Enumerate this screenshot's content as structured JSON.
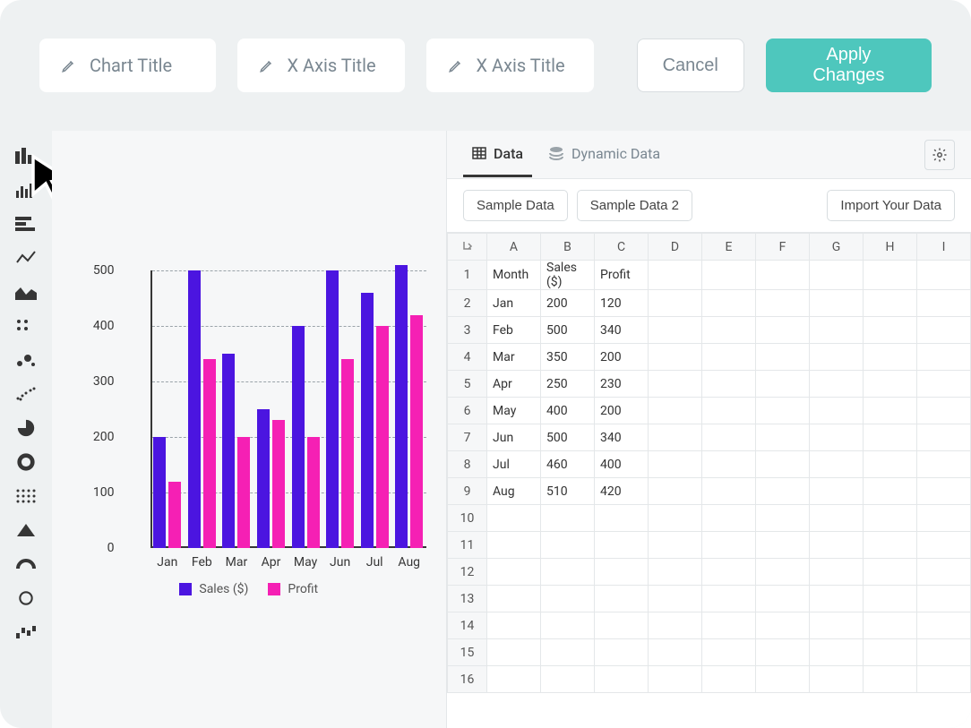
{
  "topbar": {
    "chart_title_placeholder": "Chart Title",
    "x_axis_placeholder": "X Axis Title",
    "y_axis_placeholder": "X Axis Title",
    "cancel_label": "Cancel",
    "apply_label": "Apply Changes"
  },
  "tabs": {
    "data_label": "Data",
    "dynamic_label": "Dynamic Data"
  },
  "data_toolbar": {
    "sample1": "Sample Data",
    "sample2": "Sample Data 2",
    "import": "Import Your Data"
  },
  "sheet": {
    "columns": [
      "A",
      "B",
      "C",
      "D",
      "E",
      "F",
      "G",
      "H",
      "I"
    ],
    "rows": [
      {
        "n": "1",
        "cells": [
          "Month",
          "Sales ($)",
          "Profit",
          "",
          "",
          "",
          "",
          "",
          ""
        ]
      },
      {
        "n": "2",
        "cells": [
          "Jan",
          "200",
          "120",
          "",
          "",
          "",
          "",
          "",
          ""
        ]
      },
      {
        "n": "3",
        "cells": [
          "Feb",
          "500",
          "340",
          "",
          "",
          "",
          "",
          "",
          ""
        ]
      },
      {
        "n": "4",
        "cells": [
          "Mar",
          "350",
          "200",
          "",
          "",
          "",
          "",
          "",
          ""
        ]
      },
      {
        "n": "5",
        "cells": [
          "Apr",
          "250",
          "230",
          "",
          "",
          "",
          "",
          "",
          ""
        ]
      },
      {
        "n": "6",
        "cells": [
          "May",
          "400",
          "200",
          "",
          "",
          "",
          "",
          "",
          ""
        ]
      },
      {
        "n": "7",
        "cells": [
          "Jun",
          "500",
          "340",
          "",
          "",
          "",
          "",
          "",
          ""
        ]
      },
      {
        "n": "8",
        "cells": [
          "Jul",
          "460",
          "400",
          "",
          "",
          "",
          "",
          "",
          ""
        ]
      },
      {
        "n": "9",
        "cells": [
          "Aug",
          "510",
          "420",
          "",
          "",
          "",
          "",
          "",
          ""
        ]
      },
      {
        "n": "10",
        "cells": [
          "",
          "",
          "",
          "",
          "",
          "",
          "",
          "",
          ""
        ]
      },
      {
        "n": "11",
        "cells": [
          "",
          "",
          "",
          "",
          "",
          "",
          "",
          "",
          ""
        ]
      },
      {
        "n": "12",
        "cells": [
          "",
          "",
          "",
          "",
          "",
          "",
          "",
          "",
          ""
        ]
      },
      {
        "n": "13",
        "cells": [
          "",
          "",
          "",
          "",
          "",
          "",
          "",
          "",
          ""
        ]
      },
      {
        "n": "14",
        "cells": [
          "",
          "",
          "",
          "",
          "",
          "",
          "",
          "",
          ""
        ]
      },
      {
        "n": "15",
        "cells": [
          "",
          "",
          "",
          "",
          "",
          "",
          "",
          "",
          ""
        ]
      },
      {
        "n": "16",
        "cells": [
          "",
          "",
          "",
          "",
          "",
          "",
          "",
          "",
          ""
        ]
      }
    ]
  },
  "chart_data": {
    "type": "bar",
    "categories": [
      "Jan",
      "Feb",
      "Mar",
      "Apr",
      "May",
      "Jun",
      "Jul",
      "Aug"
    ],
    "series": [
      {
        "name": "Sales ($)",
        "values": [
          200,
          500,
          350,
          250,
          400,
          500,
          460,
          510
        ],
        "color": "#4b15e0"
      },
      {
        "name": "Profit",
        "values": [
          120,
          340,
          200,
          230,
          200,
          340,
          400,
          420
        ],
        "color": "#f520b4"
      }
    ],
    "ylim": [
      0,
      500
    ],
    "yticks": [
      0,
      100,
      200,
      300,
      400,
      500
    ],
    "title": "",
    "xlabel": "",
    "ylabel": ""
  },
  "colors": {
    "accent": "#4ec7bd",
    "series_a": "#4b15e0",
    "series_b": "#f520b4"
  }
}
